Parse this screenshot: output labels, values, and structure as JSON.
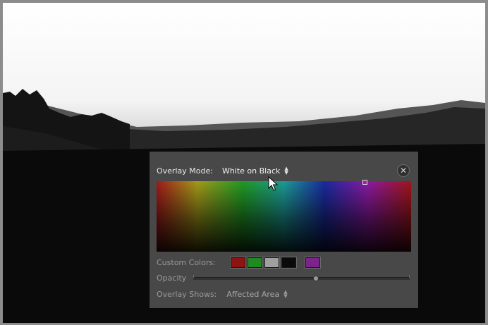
{
  "panel": {
    "overlay_mode_label": "Overlay Mode:",
    "overlay_mode_value": "White on Black",
    "custom_colors_label": "Custom Colors:",
    "custom_colors": [
      "#8e1414",
      "#1f8a1f",
      "#a0a0a0",
      "#0a0a0a",
      "#7a248c"
    ],
    "opacity_label": "Opacity",
    "opacity_value": 0.57,
    "overlay_shows_label": "Overlay Shows:",
    "overlay_shows_value": "Affected Area"
  },
  "icons": {
    "close": "close-icon",
    "updown": "updown-arrows-icon",
    "cursor": "mouse-pointer-icon"
  }
}
